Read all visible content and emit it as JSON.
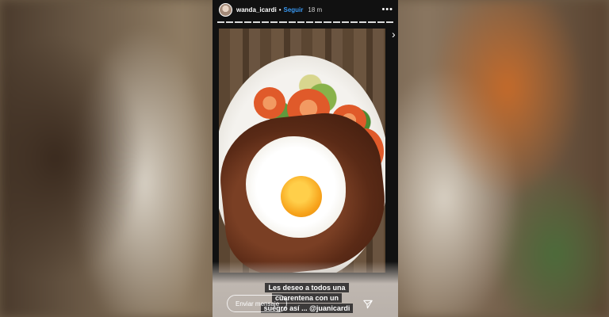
{
  "story": {
    "username": "wanda_icardi",
    "separator": "•",
    "follow_label": "Seguir",
    "timestamp": "18 m",
    "more_icon": "more-horizontal-icon",
    "progress_segments": 20,
    "caption_lines": [
      "Les deseo a todos una",
      "cuarentena con un",
      "suegro así ... @juanicardi"
    ],
    "reply_placeholder": "Enviar mensaje",
    "send_icon": "send-icon",
    "next_icon": "chevron-right-icon"
  }
}
